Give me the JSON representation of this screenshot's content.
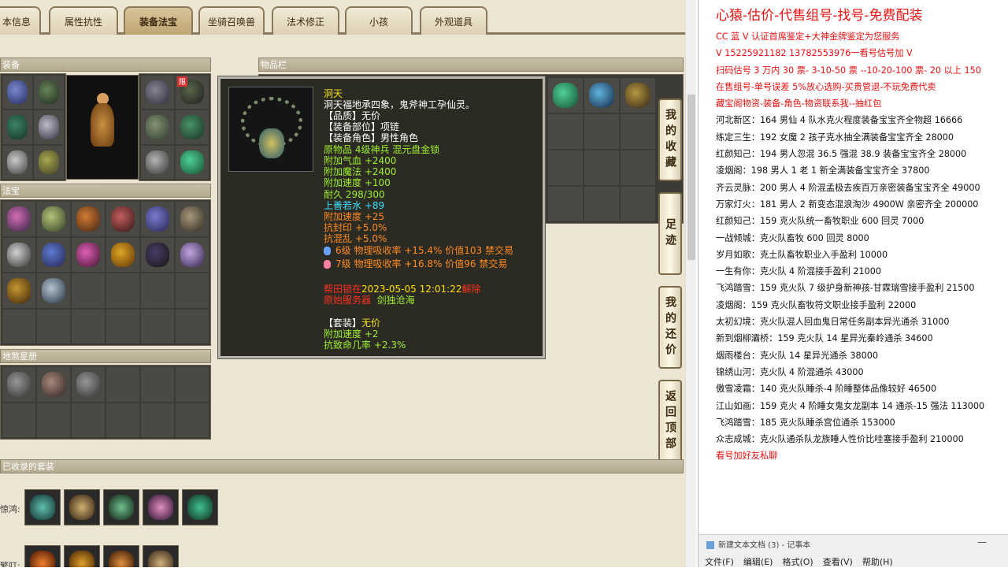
{
  "tabs": [
    "本信息",
    "属性抗性",
    "装备法宝",
    "坐骑召唤兽",
    "法术修正",
    "小孩",
    "外观道具"
  ],
  "active_tab": "装备法宝",
  "sections": {
    "equipment": "装备",
    "fabao": "法宝",
    "star": "地煞星册",
    "inventory": "物品栏",
    "suits": "已收录的套装",
    "badge": "限"
  },
  "suit_row_labels": [
    "惊鸿:",
    "繁叮:"
  ],
  "side_buttons": [
    "我的收藏",
    "足迹",
    "我的还价",
    "返回顶部"
  ],
  "tooltip": {
    "name": "洞天",
    "desc": "洞天福地承四象，鬼斧神工孕仙灵。",
    "quality": "【品质】无价",
    "slot": "【装备部位】项链",
    "role": "【装备角色】男性角色",
    "origin": "原物品 4级神兵 混元盘金锁",
    "stats": [
      "附加气血 +2400",
      "附加魔法 +2400",
      "附加速度 +100",
      "耐久 298/300"
    ],
    "shangshan": "上善若水 +89",
    "speed": "附加速度 +25",
    "resists": [
      "抗封印 +5.0%",
      "抗混乱 +5.0%"
    ],
    "gems": [
      "6级 物理吸收率 +15.4% 价值103 禁交易",
      "7级 物理吸收率 +16.8% 价值96 禁交易"
    ],
    "bind_prefix": "帮田锁在",
    "bind_time": "2023-05-05 12:01:22",
    "bind_suffix": "解除",
    "server_label": "原始服务器",
    "server": "剑独沧海",
    "set_title": "【套装】",
    "set_value": "无价",
    "set_stats": [
      "附加速度 +2",
      "抗致命几率 +2.3%"
    ]
  },
  "notepad": {
    "lines": [
      {
        "t": "心猿-估价-代售组号-找号-免费配装",
        "s": "big red"
      },
      {
        "t": "CC 蓝 V 认证首席鉴定+大神金牌鉴定为您服务",
        "s": "red"
      },
      {
        "t": "V 15225921182      13782553976一看号估号加 V",
        "s": "red"
      },
      {
        "t": "扫码估号 3 万内 30 票- 3-10-50 票  --10-20-100 票- 20 以上 150",
        "s": "red"
      },
      {
        "t": "在售组号-单号误差 5%放心选购-买贵管退-不玩免费代卖",
        "s": "red"
      },
      {
        "t": "藏宝阁物资-装备-角色-物资联系我--抽红包",
        "s": "red"
      },
      {
        "t": "河北新区：164 男仙 4 队水克火程度装备宝宝齐全物超 16666",
        "s": ""
      },
      {
        "t": "练定三生：192 女魔 2 孩子克水抽全满装备宝宝齐全 28000",
        "s": ""
      },
      {
        "t": "红颜知己：194 男人忽混 36.5 强混 38.9 装备宝宝齐全 28000",
        "s": ""
      },
      {
        "t": "凌烟阁：198 男人 1 老 1 新全满装备宝宝齐全 37800",
        "s": ""
      },
      {
        "t": "齐云灵脉：200 男人 4 阶混孟极去疾百万亲密装备宝宝齐全 49000",
        "s": ""
      },
      {
        "t": "万家灯火：181 男人 2 新变态混浪淘沙 4900W 亲密齐全 200000",
        "s": ""
      },
      {
        "t": "红颜知己：159 克火队统一畜牧职业 600 回灵 7000",
        "s": ""
      },
      {
        "t": "一战倾城：克火队畜牧 600 回灵 8000",
        "s": ""
      },
      {
        "t": "岁月如歌：克土队畜牧职业入手盈利 10000",
        "s": ""
      },
      {
        "t": "一生有你：克火队 4 阶混接手盈利 21000",
        "s": ""
      },
      {
        "t": "飞鸿踏雪：159 克火队 7 级护身新神孩-甘霖瑞雪接手盈利 21500",
        "s": ""
      },
      {
        "t": "凌烟阁：159 克火队畜牧符文职业接手盈利 22000",
        "s": ""
      },
      {
        "t": "太初幻境：克火队混人回血鬼日常任务副本异光通杀 31000",
        "s": ""
      },
      {
        "t": "新到烟柳灞桥：159 克火队 14 星异光秦岭通杀 34600",
        "s": ""
      },
      {
        "t": "烟雨楼台：克火队 14 星异光通杀 38000",
        "s": ""
      },
      {
        "t": "锦绣山河：克火队 4 阶混通杀 43000",
        "s": ""
      },
      {
        "t": "傲雪凌霜：140 克火队睡杀-4 阶睡整体品像较好 46500",
        "s": ""
      },
      {
        "t": "江山如画：159 克火 4 阶睡女鬼女龙副本 14 通杀-15 强法 113000",
        "s": ""
      },
      {
        "t": "飞鸿踏雪：185 克火队睡杀宫位通杀 153000",
        "s": ""
      },
      {
        "t": "众志成城：克火队通杀队龙族睡人性价比哇塞接手盈利 210000",
        "s": ""
      },
      {
        "t": "看号加好友私聊",
        "s": "red"
      }
    ],
    "title": "新建文本文档 (3) - 记事本",
    "menu": [
      "文件(F)",
      "编辑(E)",
      "格式(O)",
      "查看(V)",
      "帮助(H)"
    ],
    "minimize": "—"
  }
}
